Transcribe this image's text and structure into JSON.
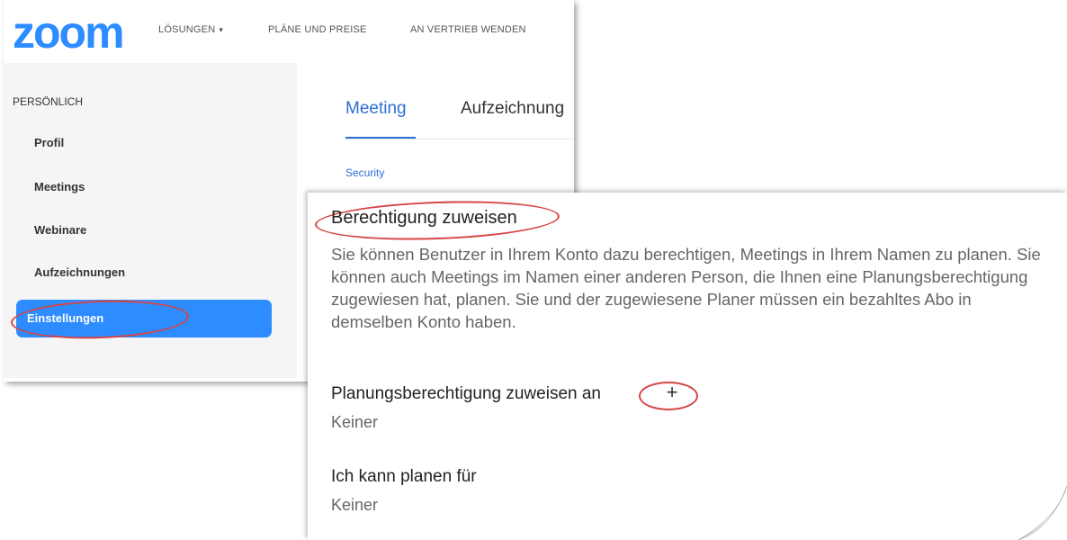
{
  "brand": {
    "logo_text": "zoom",
    "color": "#2d8cff"
  },
  "topnav": {
    "items": [
      {
        "label": "LÖSUNGEN",
        "has_caret": true
      },
      {
        "label": "PLÄNE UND PREISE"
      },
      {
        "label": "AN VERTRIEB WENDEN"
      }
    ],
    "caret_glyph": "▾"
  },
  "sidebar": {
    "heading": "PERSÖNLICH",
    "items": [
      {
        "label": "Profil"
      },
      {
        "label": "Meetings"
      },
      {
        "label": "Webinare"
      },
      {
        "label": "Aufzeichnungen"
      },
      {
        "label": "Einstellungen",
        "active": true
      }
    ]
  },
  "tabs": [
    {
      "label": "Meeting",
      "active": true
    },
    {
      "label": "Aufzeichnung"
    }
  ],
  "section_link": "Security",
  "permission": {
    "title": "Berechtigung zuweisen",
    "description": "Sie können Benutzer in Ihrem Konto dazu berechtigen, Meetings in Ihrem Namen zu planen. Sie können auch Meetings im Namen einer anderen Person, die Ihnen eine Planungsberechtigung zugewiesen hat, planen. Sie und der zugewiesene Planer müssen ein bezahltes Abo in demselben Konto haben.",
    "assign_label": "Planungsberechtigung zuweisen an",
    "assign_button": "+",
    "assign_value": "Keiner",
    "schedule_for_label": "Ich kann planen für",
    "schedule_for_value": "Keiner"
  },
  "colors": {
    "accent": "#2d8cff",
    "highlight_ring": "#d64545",
    "tab_active": "#2d6fd6"
  }
}
